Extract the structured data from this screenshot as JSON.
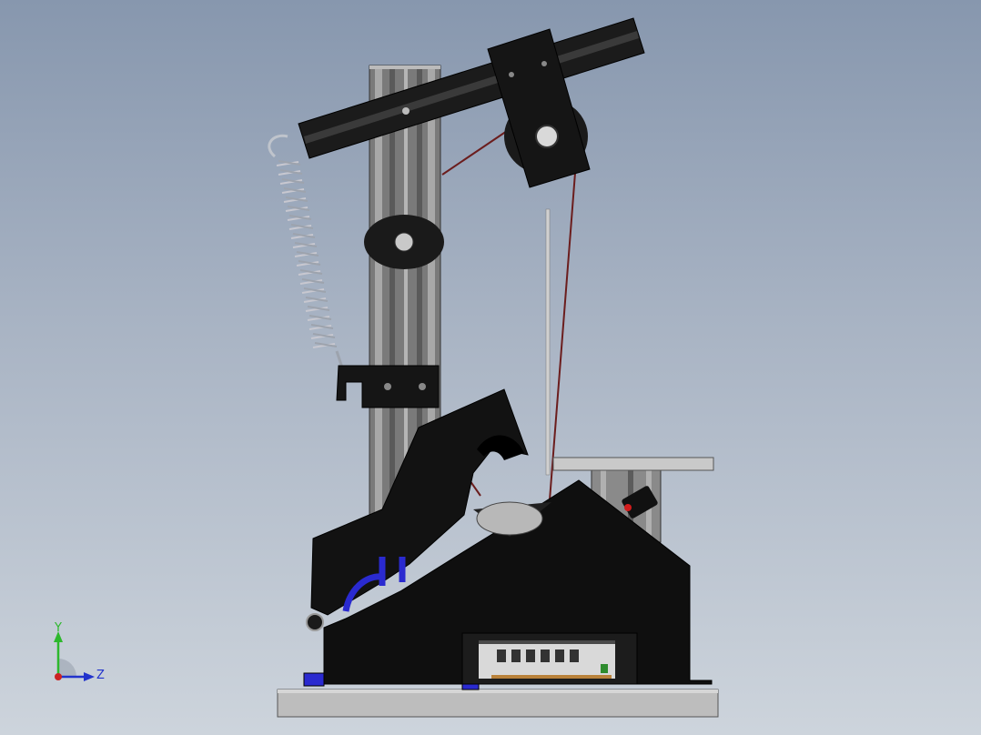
{
  "viewport": {
    "background_top": "#8797ae",
    "background_bottom": "#cdd4dc"
  },
  "triad": {
    "y_label": "Y",
    "z_label": "Z",
    "y_color": "#2db82d",
    "z_color": "#2233cc",
    "x_color": "#cc2222"
  },
  "colors": {
    "body": "#111111",
    "rail": "#6e6e6e",
    "rail_light": "#a9a9a9",
    "accent_blue": "#2a2ad0",
    "base_plate": "#bdbdbd",
    "cable": "#6b1d1d",
    "spring": "#c8c8d0"
  }
}
